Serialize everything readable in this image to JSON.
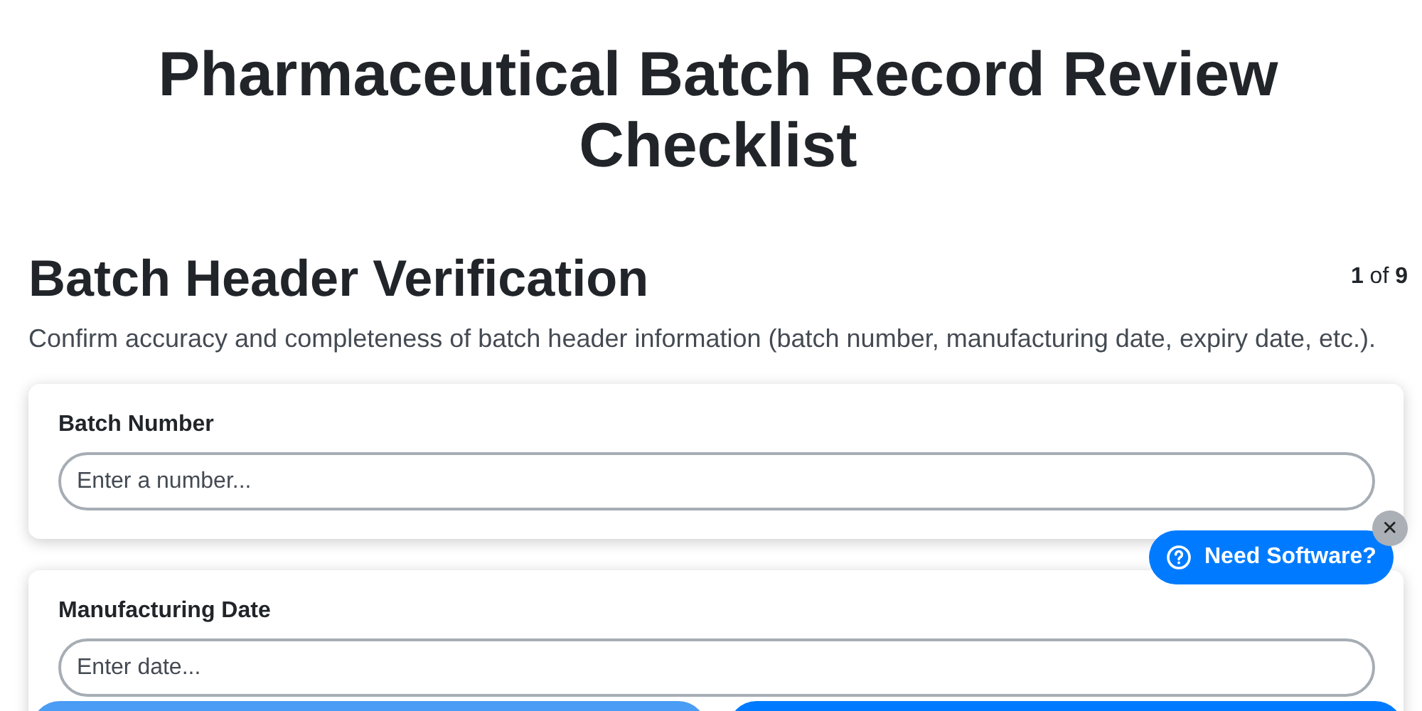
{
  "title": "Pharmaceutical Batch Record Review Checklist",
  "section": {
    "heading": "Batch Header Verification",
    "counter": {
      "current": "1",
      "of": "of",
      "total": "9"
    },
    "description": "Confirm accuracy and completeness of batch header information (batch number, manufacturing date, expiry date, etc.)."
  },
  "fields": [
    {
      "label": "Batch Number",
      "placeholder": "Enter a number..."
    },
    {
      "label": "Manufacturing Date",
      "placeholder": "Enter date..."
    }
  ],
  "nav_buttons": [
    {
      "disabled": true
    },
    {
      "disabled": false
    }
  ],
  "help_widget": {
    "label": "Need Software?",
    "close": "✕"
  }
}
